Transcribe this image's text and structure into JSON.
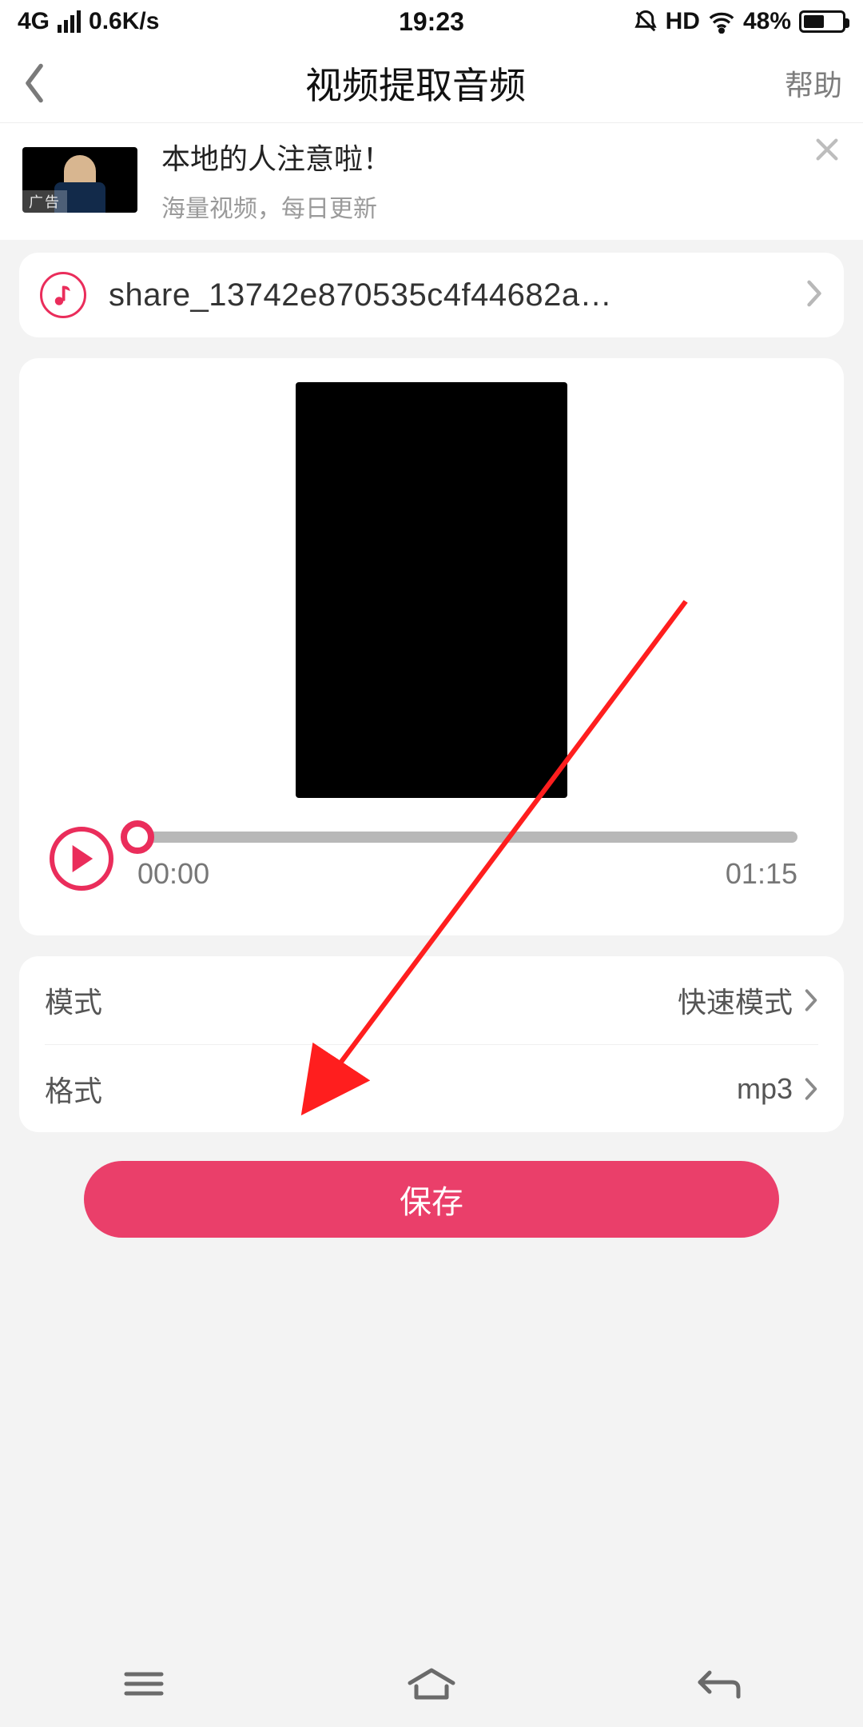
{
  "status_bar": {
    "network_label": "4G",
    "speed": "0.6K/s",
    "time": "19:23",
    "hd_label": "HD",
    "battery_pct": "48%"
  },
  "header": {
    "title": "视频提取音频",
    "help_label": "帮助"
  },
  "ad": {
    "tag": "广告",
    "title": "本地的人注意啦！",
    "subtitle": "海量视频，每日更新"
  },
  "file": {
    "name": "share_13742e870535c4f44682a…"
  },
  "player": {
    "current_time": "00:00",
    "total_time": "01:15"
  },
  "options": {
    "mode_label": "模式",
    "mode_value": "快速模式",
    "format_label": "格式",
    "format_value": "mp3"
  },
  "save_label": "保存"
}
